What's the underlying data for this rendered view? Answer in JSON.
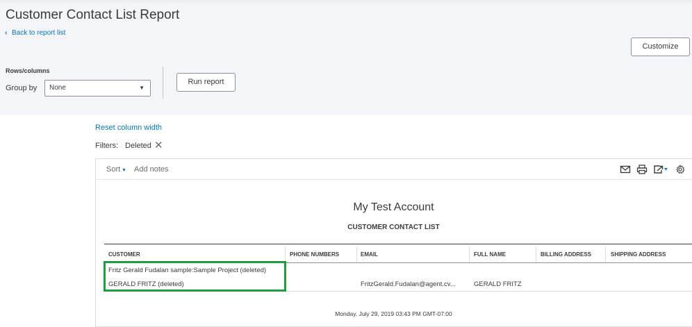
{
  "page": {
    "title": "Customer Contact List Report",
    "back_link": "Back to report list",
    "customize_label": "Customize"
  },
  "controls": {
    "rows_columns_label": "Rows/columns",
    "group_by_label": "Group by",
    "group_by_value": "None",
    "run_report_label": "Run report"
  },
  "filters": {
    "reset_column_width": "Reset column width",
    "label": "Filters:",
    "chips": [
      "Deleted"
    ]
  },
  "toolbar": {
    "sort_label": "Sort",
    "add_notes_label": "Add notes",
    "icons": [
      "email-icon",
      "print-icon",
      "export-icon",
      "settings-gear-icon"
    ]
  },
  "report": {
    "account_name": "My Test Account",
    "report_title": "CUSTOMER CONTACT LIST",
    "columns": [
      "CUSTOMER",
      "PHONE NUMBERS",
      "EMAIL",
      "FULL NAME",
      "BILLING ADDRESS",
      "SHIPPING ADDRESS"
    ],
    "rows": [
      {
        "customer": "Fritz Gerald Fudalan sample:Sample Project (deleted)",
        "phone": "",
        "email": "",
        "full_name": "",
        "billing": "",
        "shipping": ""
      },
      {
        "customer": "GERALD FRITZ (deleted)",
        "phone": "",
        "email": "FritzGerald.Fudalan@agent.cv...",
        "full_name": "GERALD FRITZ",
        "billing": "",
        "shipping": ""
      }
    ],
    "timestamp": "Monday, July 29, 2019   03:43 PM GMT-07:00"
  },
  "colors": {
    "link": "#0077c5",
    "highlight": "#1c9e3e",
    "panel_bg": "#f4f5f8"
  }
}
